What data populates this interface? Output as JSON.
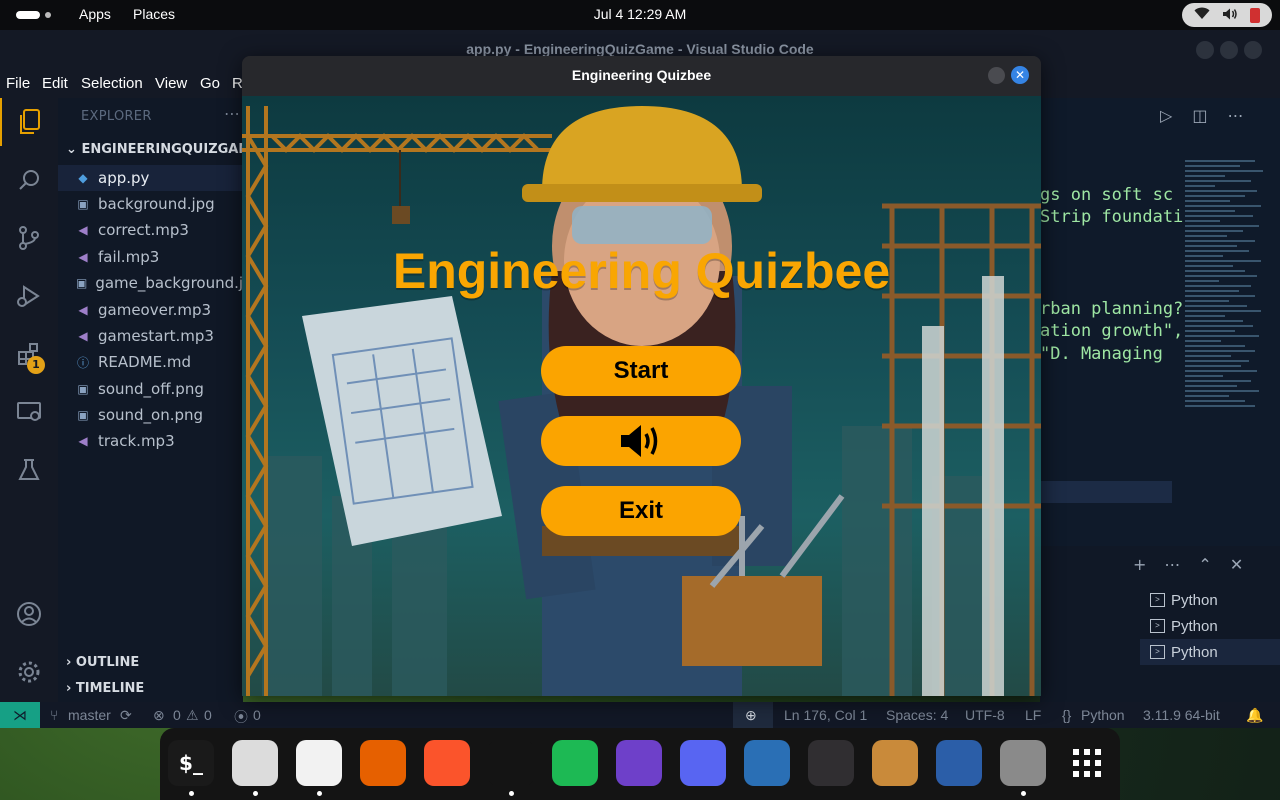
{
  "topbar": {
    "apps_label": "Apps",
    "places_label": "Places",
    "clock": "Jul 4  12:29 AM",
    "tray": {
      "wifi_icon": "wifi-icon",
      "volume_icon": "volume-icon",
      "battery_icon": "battery-icon",
      "battery_color": "#d03030"
    }
  },
  "vscode": {
    "window_title": "app.py - EngineeringQuizGame - Visual Studio Code",
    "menu": [
      "File",
      "Edit",
      "Selection",
      "View",
      "Go",
      "R"
    ],
    "activity_badge": "1",
    "explorer": {
      "header": "EXPLORER",
      "project": "ENGINEERINGQUIZGAME",
      "files": [
        {
          "name": "app.py",
          "type": "python"
        },
        {
          "name": "background.jpg",
          "type": "image"
        },
        {
          "name": "correct.mp3",
          "type": "audio"
        },
        {
          "name": "fail.mp3",
          "type": "audio"
        },
        {
          "name": "game_background.jpg",
          "type": "image"
        },
        {
          "name": "gameover.mp3",
          "type": "audio"
        },
        {
          "name": "gamestart.mp3",
          "type": "audio"
        },
        {
          "name": "README.md",
          "type": "info"
        },
        {
          "name": "sound_off.png",
          "type": "image"
        },
        {
          "name": "sound_on.png",
          "type": "image"
        },
        {
          "name": "track.mp3",
          "type": "audio"
        }
      ],
      "outline": "OUTLINE",
      "timeline": "TIMELINE"
    },
    "code_fragments": [
      "gs on soft sc",
      "Strip foundati",
      "rban planning?",
      "ation growth\",",
      " \"D. Managing "
    ],
    "terminals": [
      "Python",
      "Python",
      "Python"
    ],
    "status": {
      "branch": "master",
      "errors": "0",
      "warnings": "0",
      "ports": "0",
      "position": "Ln 176, Col 1",
      "spaces": "Spaces: 4",
      "encoding": "UTF-8",
      "eol": "LF",
      "language": "Python",
      "interpreter": "3.11.9 64-bit"
    }
  },
  "game": {
    "window_title": "Engineering Quizbee",
    "heading": "Engineering Quizbee",
    "buttons": {
      "start": "Start",
      "sound_icon": "speaker-icon",
      "exit": "Exit"
    },
    "colors": {
      "accent": "#fba400",
      "heading": "#f9a602"
    }
  },
  "dock": {
    "apps": [
      {
        "name": "terminal",
        "glyph": "$_",
        "bg": "#1a1a1a",
        "running": true
      },
      {
        "name": "files",
        "glyph": "",
        "bg": "#dcdcdc",
        "running": true
      },
      {
        "name": "text-editor",
        "glyph": "",
        "bg": "#f2f2f2",
        "running": true
      },
      {
        "name": "firefox",
        "glyph": "",
        "bg": "#e66000",
        "running": false
      },
      {
        "name": "brave",
        "glyph": "",
        "bg": "#fb542b",
        "running": false
      },
      {
        "name": "vscode",
        "glyph": "",
        "bg": "#141414",
        "running": true
      },
      {
        "name": "spotify",
        "glyph": "",
        "bg": "#1db954",
        "running": false
      },
      {
        "name": "github-desktop",
        "glyph": "",
        "bg": "#6e40c9",
        "running": false
      },
      {
        "name": "discord",
        "glyph": "",
        "bg": "#5865f2",
        "running": false
      },
      {
        "name": "steam",
        "glyph": "",
        "bg": "#2a6fb5",
        "running": false
      },
      {
        "name": "obs-studio",
        "glyph": "",
        "bg": "#302e31",
        "running": false
      },
      {
        "name": "chicken-game",
        "glyph": "",
        "bg": "#c98a3a",
        "running": false
      },
      {
        "name": "kdenlive",
        "glyph": "",
        "bg": "#2b5ea8",
        "running": false
      },
      {
        "name": "settings",
        "glyph": "",
        "bg": "#8a8a8a",
        "running": true
      },
      {
        "name": "show-apps",
        "glyph": "",
        "bg": "#141414",
        "running": false
      }
    ]
  }
}
